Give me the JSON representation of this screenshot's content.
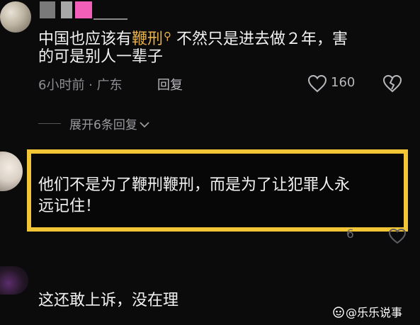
{
  "comment1": {
    "line1_before": "中国也应该有",
    "line1_keyword": "鞭刑",
    "line1_after": "不然只是进去做２年，害",
    "line2": "的可是别人一辈子",
    "time": "6小时前 · 广东",
    "reply_label": "回复",
    "likes": "160"
  },
  "expand_replies": "展开6条回复",
  "comment2": {
    "line1": "他们不是为了鞭刑鞭刑，而是为了让犯罪人永",
    "line2": "远记住！",
    "likes_partial": "6"
  },
  "comment3": {
    "text": "这还敢上诉，没在理"
  },
  "watermark": "@乐乐说事",
  "colors": {
    "background": "#0b0b0c",
    "highlight_border": "#f2c537",
    "keyword": "#e8b24a",
    "meta": "#8e8e93",
    "username_accent": "#f25fb8"
  },
  "icons": [
    "search-keyword-icon",
    "heart-icon",
    "broken-heart-icon",
    "chevron-down-icon",
    "watermark-logo-icon"
  ]
}
